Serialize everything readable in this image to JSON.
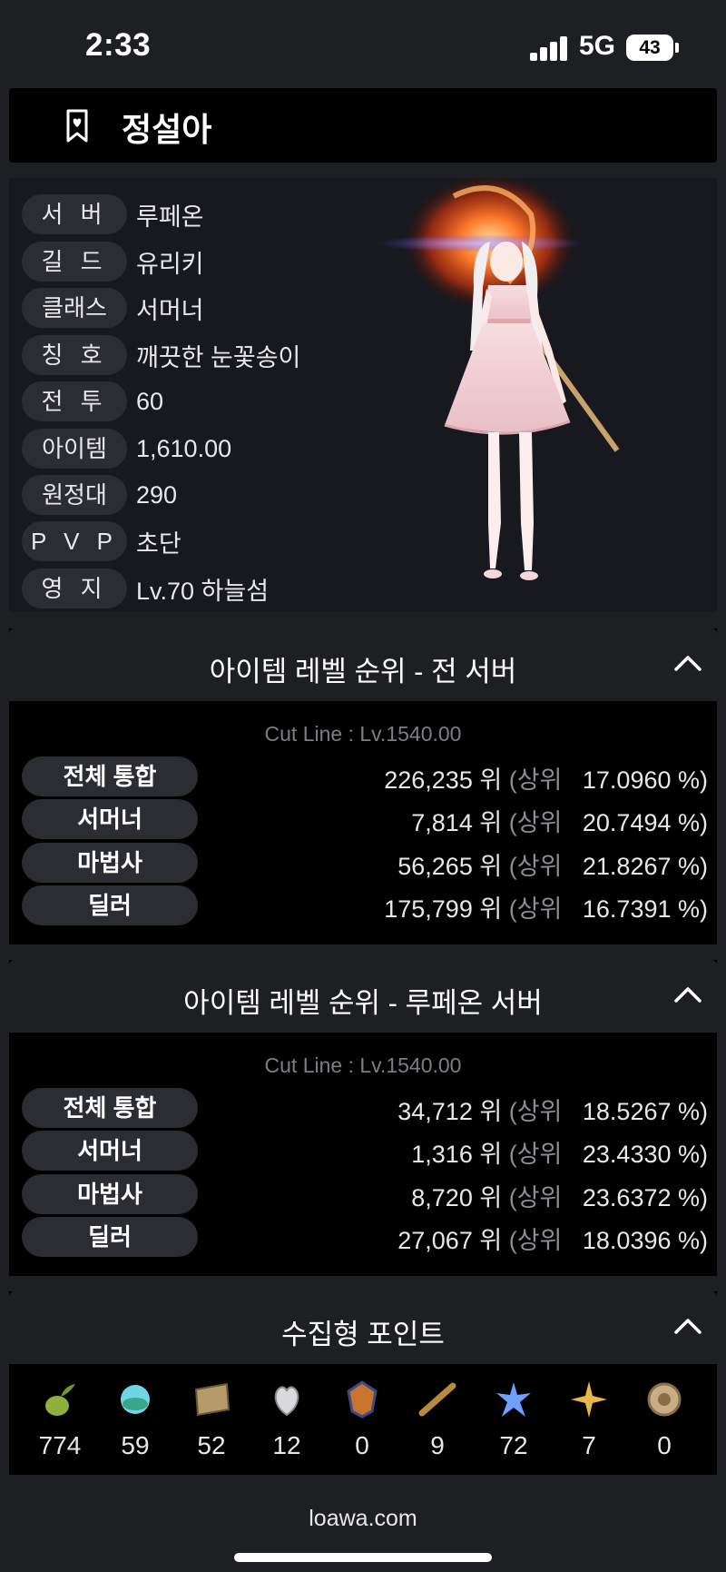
{
  "status_bar": {
    "time": "2:33",
    "network": "5G",
    "battery": "43"
  },
  "header": {
    "character_name": "정설아"
  },
  "profile": {
    "rows": [
      {
        "label": "서 버",
        "value": "루페온"
      },
      {
        "label": "길 드",
        "value": "유리키"
      },
      {
        "label": "클래스",
        "value": "서머너"
      },
      {
        "label": "칭 호",
        "value": "깨끗한 눈꽃송이"
      },
      {
        "label": "전 투",
        "value": "60"
      },
      {
        "label": "아이템",
        "value": "1,610.00"
      },
      {
        "label": "원정대",
        "value": "290"
      },
      {
        "label": "P V P",
        "value": "초단"
      },
      {
        "label": "영 지",
        "value": "Lv.70 하늘섬"
      }
    ]
  },
  "ranking_all": {
    "title": "아이템 레벨 순위 - 전 서버",
    "cutline": "Cut Line : Lv.1540.00",
    "rows": [
      {
        "label": "전체 통합",
        "rank": "226,235 위",
        "upper": "(상위",
        "pct": "17.0960 %)"
      },
      {
        "label": "서머너",
        "rank": "7,814 위",
        "upper": "(상위",
        "pct": "20.7494 %)"
      },
      {
        "label": "마법사",
        "rank": "56,265 위",
        "upper": "(상위",
        "pct": "21.8267 %)"
      },
      {
        "label": "딜러",
        "rank": "175,799 위",
        "upper": "(상위",
        "pct": "16.7391 %)"
      }
    ]
  },
  "ranking_server": {
    "title": "아이템 레벨 순위 - 루페온 서버",
    "cutline": "Cut Line : Lv.1540.00",
    "rows": [
      {
        "label": "전체 통합",
        "rank": "34,712 위",
        "upper": "(상위",
        "pct": "18.5267 %)"
      },
      {
        "label": "서머너",
        "rank": "1,316 위",
        "upper": "(상위",
        "pct": "23.4330 %)"
      },
      {
        "label": "마법사",
        "rank": "8,720 위",
        "upper": "(상위",
        "pct": "23.6372 %)"
      },
      {
        "label": "딜러",
        "rank": "27,067 위",
        "upper": "(상위",
        "pct": "18.0396 %)"
      }
    ]
  },
  "collectibles": {
    "title": "수집형 포인트",
    "items": [
      {
        "icon": "mokoko-seed-icon",
        "count": "774"
      },
      {
        "icon": "island-heart-icon",
        "count": "59"
      },
      {
        "icon": "art-icon",
        "count": "52"
      },
      {
        "icon": "giant-heart-icon",
        "count": "12"
      },
      {
        "icon": "ignea-token-icon",
        "count": "0"
      },
      {
        "icon": "adventure-telescope-icon",
        "count": "9"
      },
      {
        "icon": "world-tree-leaf-icon",
        "count": "72"
      },
      {
        "icon": "orpheus-star-icon",
        "count": "7"
      },
      {
        "icon": "orb-of-masterpiece-icon",
        "count": "0"
      }
    ]
  },
  "footer": {
    "url": "loawa.com"
  }
}
